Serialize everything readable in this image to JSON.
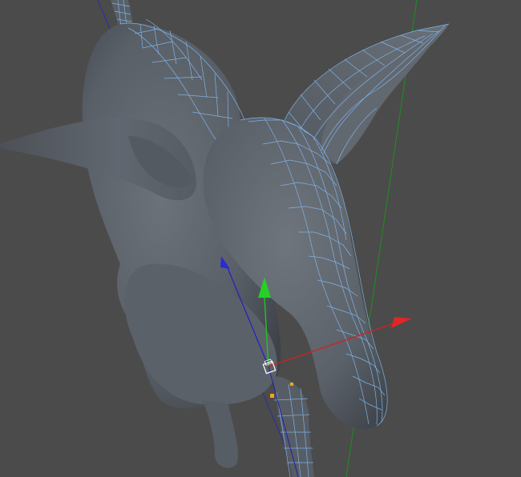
{
  "viewport": {
    "background": "#4b4b4b",
    "mesh_color": "#5f656c",
    "mesh_shadow": "#3a3e43",
    "wire_color": "#7fb2e6",
    "world_axis_blue": "#3434c8",
    "world_axis_green": "#1f9e1f",
    "gizmo_x_color": "#d42020",
    "gizmo_y_color": "#22c422",
    "gizmo_z_color": "#2424c8",
    "selection_point_color": "#f2a51a"
  },
  "icons": {
    "x_axis_arrow": "move-x-arrow-icon",
    "y_axis_arrow": "move-y-arrow-icon",
    "z_axis_arrow": "move-z-arrow-icon",
    "pivot": "pivot-square-icon"
  }
}
